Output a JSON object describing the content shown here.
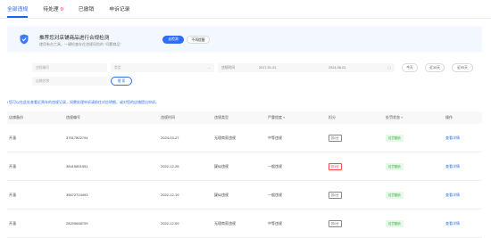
{
  "tabs": [
    {
      "label": "全部违规",
      "active": true
    },
    {
      "label": "待处理",
      "badge": "0"
    },
    {
      "label": "已撤销"
    },
    {
      "label": "申诉记录"
    }
  ],
  "banner": {
    "title": "推荐您对店铺商品进行合规检测",
    "subtitle": "使用有台工具，一键检查存在违规风险的 \"问题商品\"",
    "check_button": "去检测",
    "remind_button": "不再提醒"
  },
  "filters": {
    "violation_no_placeholder": "违规编号",
    "type_placeholder": "类型",
    "date_label": "违规时间",
    "date_start": "2017-01-01",
    "date_end": "2024-06-01",
    "store_placeholder": "店铺名称",
    "today_button": "今天",
    "last7_button": "近30天",
    "last30_button": "近90天",
    "search_button": "搜 索"
  },
  "notice": "i 您可以在此处查看近两年的违规记录，如需处理申诉请前往对应明细，或对您的店铺提出申诉。",
  "table": {
    "headers": [
      "店铺备份",
      "违规编号",
      "违规时间",
      "违规类型",
      "严重程度",
      "扣分",
      "处罚状态",
      "操作"
    ],
    "rows": [
      {
        "store": "开溜",
        "no": "37617802794",
        "time": "2024-03-27",
        "type": "无理商家违规",
        "severity": "中等违规",
        "points": "扣0分",
        "points_danger": false,
        "status": "处罚撤销",
        "action": "查看详情"
      },
      {
        "store": "开溜",
        "no": "38415851951",
        "time": "2022-12-28",
        "type": "疑似违规",
        "severity": "一般违规",
        "points": "扣1分",
        "points_danger": true,
        "status": "处罚撤销",
        "action": "查看详情"
      },
      {
        "store": "开溜",
        "no": "35672724493",
        "time": "2022-12-19",
        "type": "疑似违规",
        "severity": "一般违规",
        "points": "扣0分",
        "points_danger": false,
        "status": "处罚撤销",
        "action": "查看详情"
      },
      {
        "store": "开溜",
        "no": "28209658709",
        "time": "2022-12-09",
        "type": "无理商家违规",
        "severity": "中等违规",
        "points": "扣0分",
        "points_danger": false,
        "status": "处罚撤销",
        "action": "查看详情"
      }
    ]
  },
  "colors": {
    "accent": "#1e62ec",
    "danger": "#ff4d4f",
    "success": "#3ab54a"
  }
}
